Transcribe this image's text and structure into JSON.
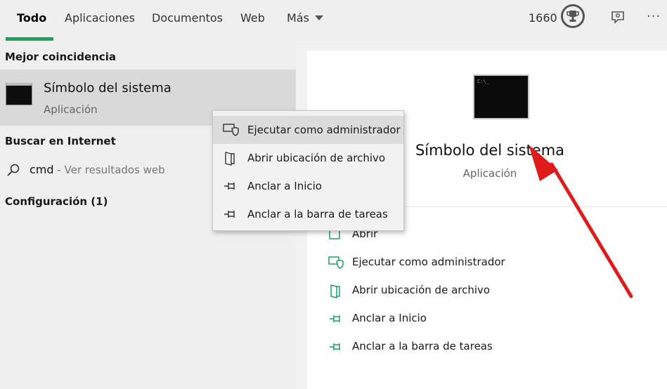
{
  "tabs": {
    "todo": "Todo",
    "aplicaciones": "Aplicaciones",
    "documentos": "Documentos",
    "web": "Web",
    "mas": "Más"
  },
  "header": {
    "points": "1660"
  },
  "results": {
    "best_match_heading": "Mejor coincidencia",
    "best_match": {
      "title": "Símbolo del sistema",
      "subtitle": "Aplicación"
    },
    "web_heading": "Buscar en Internet",
    "web_query": "cmd",
    "web_hint": " - Ver resultados web",
    "settings_heading": "Configuración (1)"
  },
  "context_menu": {
    "items": [
      "Ejecutar como administrador",
      "Abrir ubicación de archivo",
      "Anclar a Inicio",
      "Anclar a la barra de tareas"
    ]
  },
  "preview": {
    "title": "Símbolo del sistema",
    "subtitle": "Aplicación",
    "thumb_text": "C:\\_",
    "actions": [
      "Abrir",
      "Ejecutar como administrador",
      "Abrir ubicación de archivo",
      "Anclar a Inicio",
      "Anclar a la barra de tareas"
    ]
  },
  "colors": {
    "accent": "#1aa260",
    "annotation": "#e01b1b"
  }
}
